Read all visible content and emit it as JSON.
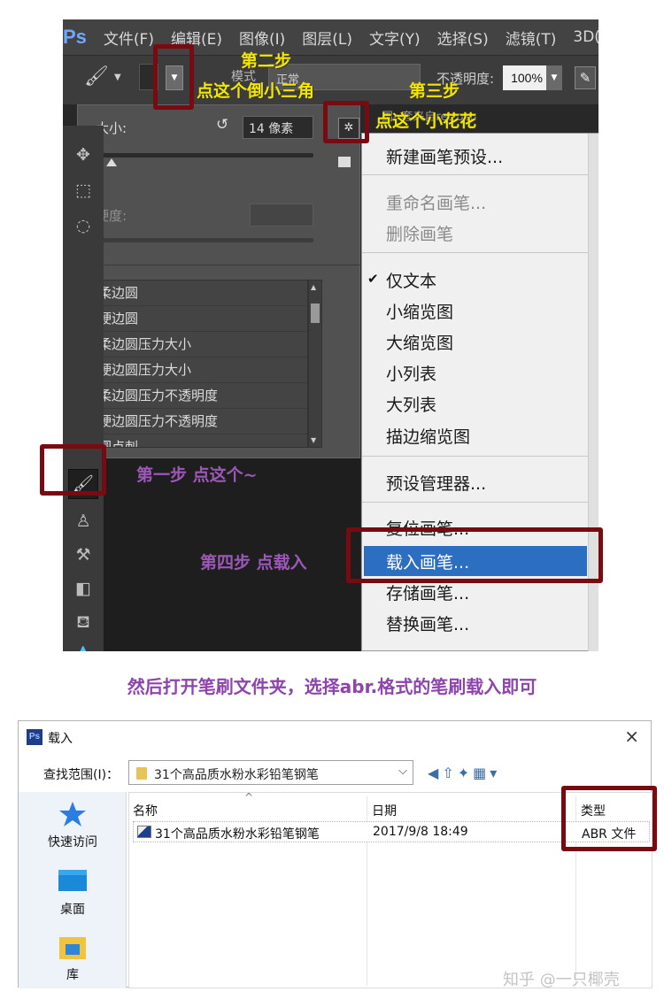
{
  "ps": {
    "logo": "Ps",
    "menu": [
      "文件(F)",
      "编辑(E)",
      "图像(I)",
      "图层(L)",
      "文字(Y)",
      "选择(S)",
      "滤镜(T)",
      "3D(D)"
    ],
    "options": {
      "mode_label": "模式",
      "mode_value": "正常",
      "opacity_label": "不透明度:",
      "opacity_value": "100%"
    },
    "doc_tab": "国--套来自retrosu",
    "brush_panel": {
      "size_label": "大小:",
      "size_value": "14 像素",
      "hardness_label": "硬度:",
      "presets": [
        "柔边圆",
        "硬边圆",
        "柔边圆压力大小",
        "硬边圆压力大小",
        "柔边圆压力不透明度",
        "硬边圆压力不透明度",
        "圆点刺"
      ]
    },
    "dropdown_menu": {
      "items": [
        {
          "label": "新建画笔预设...",
          "disabled": false
        },
        {
          "label": "重命名画笔...",
          "disabled": true
        },
        {
          "label": "删除画笔",
          "disabled": true
        },
        {
          "label": "仅文本",
          "checked": true
        },
        {
          "label": "小缩览图"
        },
        {
          "label": "大缩览图"
        },
        {
          "label": "小列表"
        },
        {
          "label": "大列表"
        },
        {
          "label": "描边缩览图"
        },
        {
          "label": "预设管理器..."
        },
        {
          "label": "复位画笔..."
        },
        {
          "label": "载入画笔...",
          "highlighted": true
        },
        {
          "label": "存储画笔..."
        },
        {
          "label": "替换画笔..."
        }
      ],
      "checkmark": "✔"
    },
    "annotations": {
      "step2_title": "第二步",
      "step2_text": "点这个倒小三角",
      "step3_title": "第三步",
      "step3_text": "点这个小花花",
      "step1_text": "第一步  点这个~",
      "step4_text": "第四步  点载入"
    }
  },
  "caption": "然后打开笔刷文件夹，选择abr.格式的笔刷载入即可",
  "dialog": {
    "icon": "Ps",
    "title": "载入",
    "close": "×",
    "look_in_label": "查找范围(I)：",
    "look_in_value": "31个高品质水粉水彩铅笔钢笔",
    "sidebar": [
      "快速访问",
      "桌面",
      "库"
    ],
    "columns": {
      "name": "名称",
      "date": "日期",
      "type": "类型"
    },
    "rows": [
      {
        "name": "31个高品质水粉水彩铅笔钢笔",
        "date": "2017/9/8 18:49",
        "type": "ABR 文件"
      }
    ]
  },
  "watermark": "知乎 @一只椰壳",
  "colors": {
    "annotation_red": "#7a0a12",
    "annotation_yellow": "#f2e600",
    "annotation_purple": "#9b58b6",
    "menu_highlight": "#2c6fc0"
  }
}
